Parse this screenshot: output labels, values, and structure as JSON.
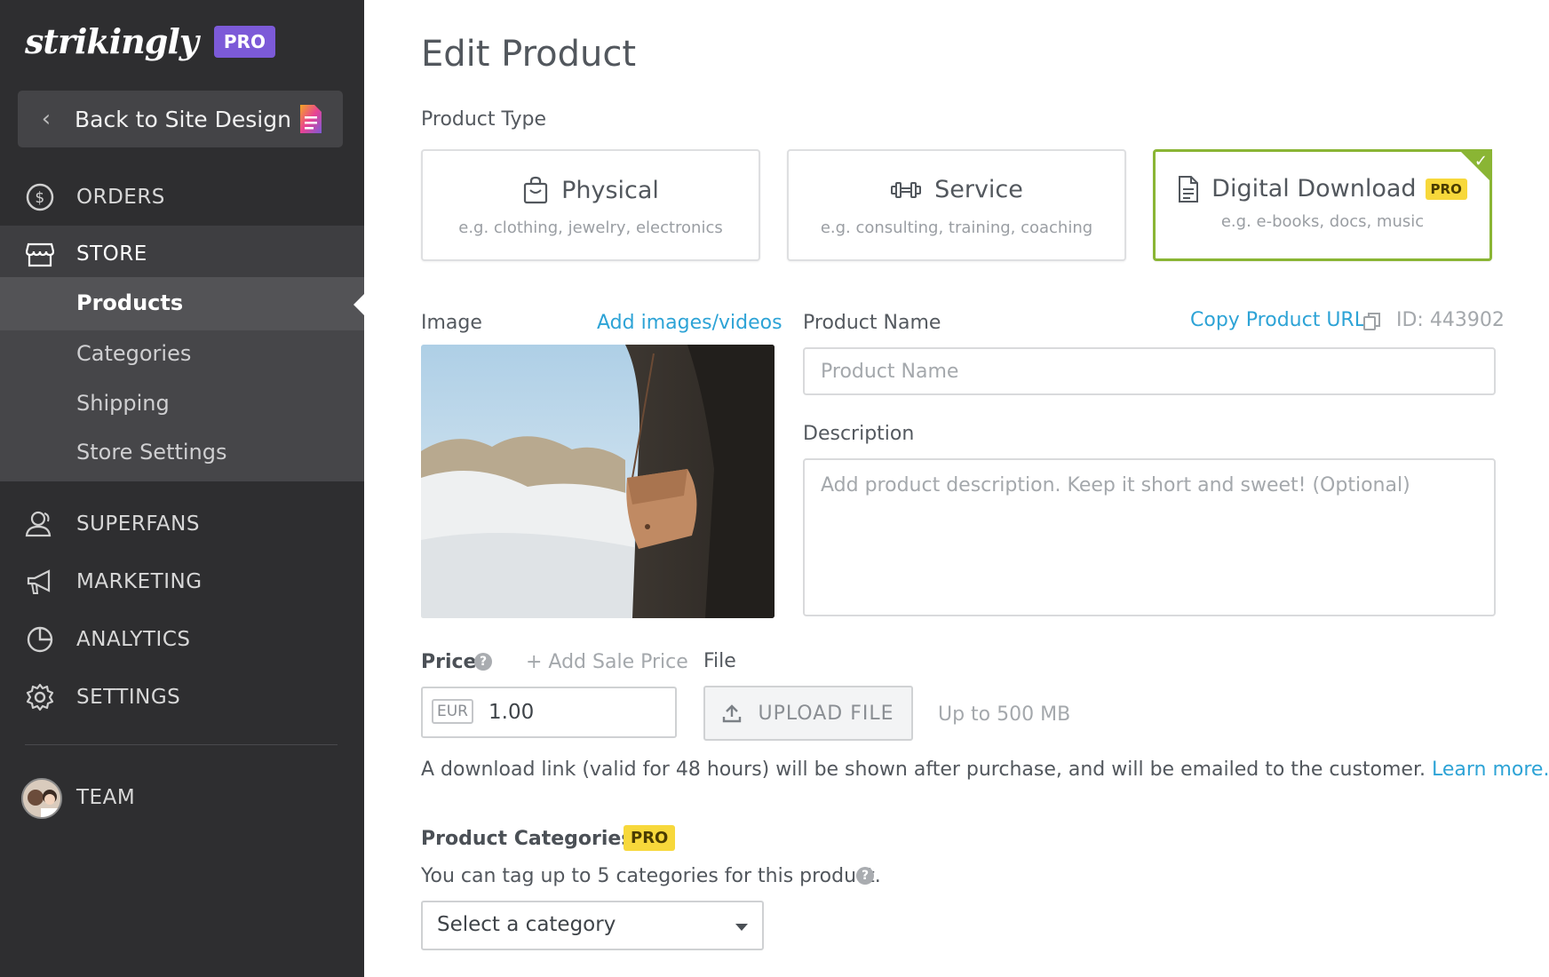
{
  "brand": {
    "name": "strikingly",
    "plan_badge": "PRO",
    "badge_color": "#7c5ad8"
  },
  "sidebar": {
    "back_label": "Back to Site Design",
    "nav": [
      {
        "label": "ORDERS",
        "icon": "dollar-circle-icon"
      },
      {
        "label": "STORE",
        "icon": "store-icon"
      },
      {
        "label": "SUPERFANS",
        "icon": "users-icon"
      },
      {
        "label": "MARKETING",
        "icon": "megaphone-icon"
      },
      {
        "label": "ANALYTICS",
        "icon": "pie-chart-icon"
      },
      {
        "label": "SETTINGS",
        "icon": "gear-icon"
      },
      {
        "label": "TEAM",
        "icon": "avatar"
      }
    ],
    "store_sub": [
      "Products",
      "Categories",
      "Shipping",
      "Store Settings"
    ],
    "active_sub": "Products"
  },
  "page": {
    "title": "Edit Product",
    "product_type_label": "Product Type",
    "types": [
      {
        "label": "Physical",
        "hint": "e.g. clothing, jewelry, electronics",
        "icon": "shopping-bag-icon"
      },
      {
        "label": "Service",
        "hint": "e.g. consulting, training, coaching",
        "icon": "dumbbell-icon"
      },
      {
        "label": "Digital Download",
        "hint": "e.g. e-books, docs, music",
        "icon": "document-icon",
        "badge": "PRO",
        "selected": true
      }
    ],
    "image_label": "Image",
    "add_media_link": "Add images/videos",
    "product_name_label": "Product Name",
    "copy_url_link": "Copy Product URL",
    "product_id": "ID: 443902",
    "product_name_placeholder": "Product Name",
    "description_label": "Description",
    "description_placeholder": "Add product description. Keep it short and sweet! (Optional)",
    "price_label": "Price",
    "add_sale_price": "+ Add Sale Price",
    "currency": "EUR",
    "price_value": "1.00",
    "file_label": "File",
    "upload_label": "UPLOAD FILE",
    "upload_limit": "Up to 500 MB",
    "download_note": "A download link (valid for 48 hours) will be shown after purchase, and will be emailed to the customer.",
    "learn_more": "Learn more.",
    "categories_label": "Product Categories",
    "categories_badge": "PRO",
    "categories_hint": "You can tag up to 5 categories for this product.",
    "category_select": "Select a category"
  },
  "colors": {
    "selected_border": "#8ab534",
    "link": "#2da3d6",
    "pro_badge": "#f7d83b",
    "sidebar_bg": "#2e2e30"
  }
}
